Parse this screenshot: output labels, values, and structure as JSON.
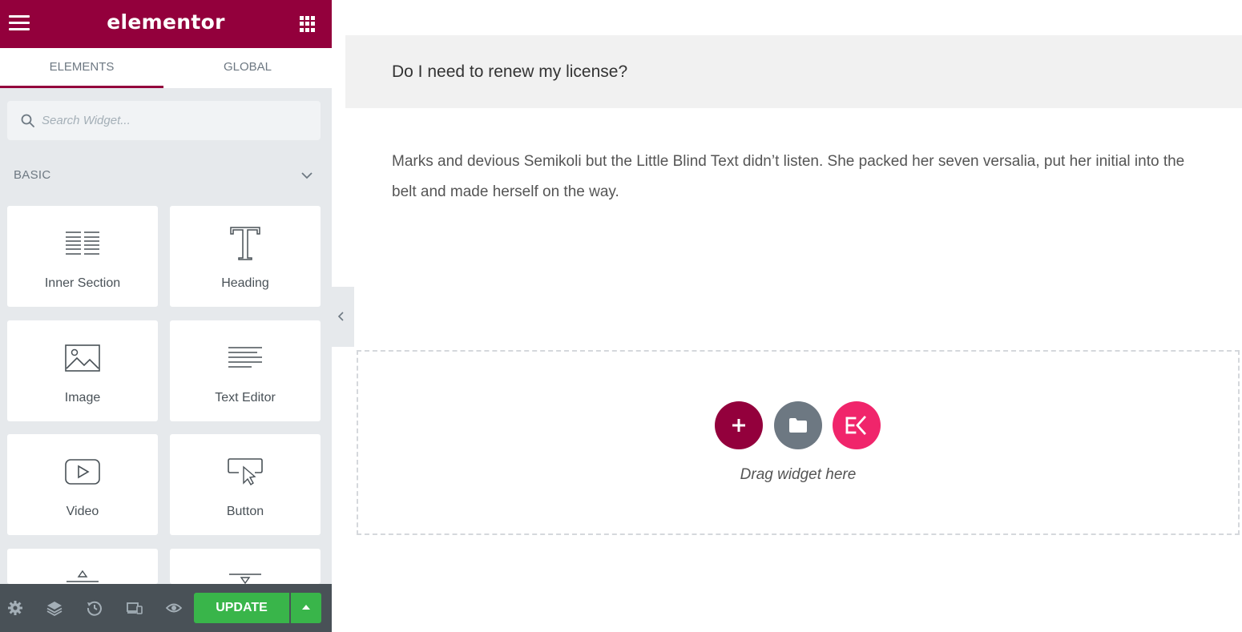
{
  "app": {
    "logo": "elementor"
  },
  "tabs": {
    "elements": "ELEMENTS",
    "global": "GLOBAL"
  },
  "search": {
    "placeholder": "Search Widget..."
  },
  "category": {
    "label": "BASIC"
  },
  "widgets": [
    {
      "label": "Inner Section",
      "icon": "inner-section-icon"
    },
    {
      "label": "Heading",
      "icon": "heading-icon"
    },
    {
      "label": "Image",
      "icon": "image-icon"
    },
    {
      "label": "Text Editor",
      "icon": "text-editor-icon"
    },
    {
      "label": "Video",
      "icon": "video-icon"
    },
    {
      "label": "Button",
      "icon": "button-icon"
    }
  ],
  "footer": {
    "update_label": "UPDATE"
  },
  "canvas": {
    "question": "Do I need to renew my license?",
    "answer": "Marks and devious Semikoli but the Little Blind Text didn’t listen. She packed her seven versalia, put her initial into the belt and made herself on the way.",
    "drag_hint": "Drag widget here"
  },
  "colors": {
    "brand": "#93003c",
    "update": "#39b54a",
    "template_button": "#6d7882",
    "kit_button": "#f0256b"
  }
}
